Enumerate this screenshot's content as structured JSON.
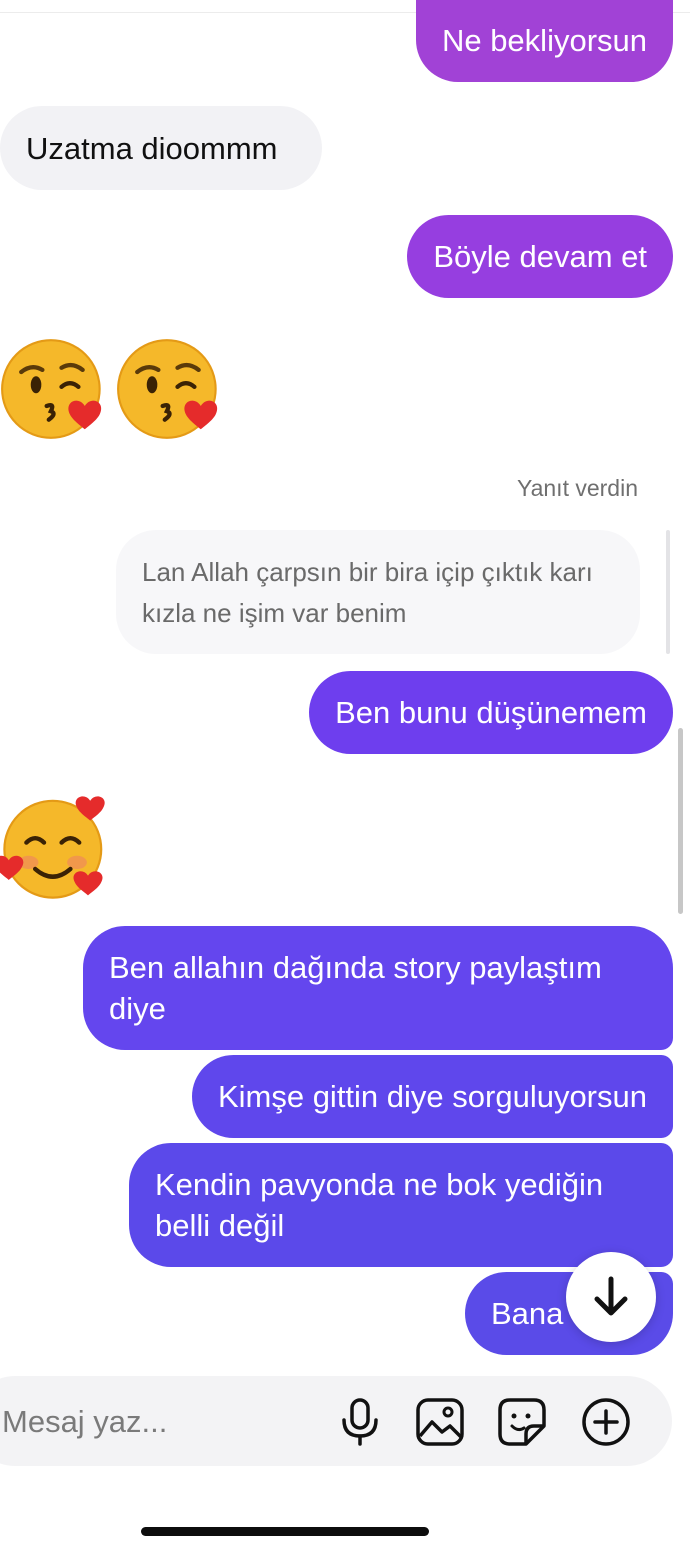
{
  "messages": {
    "m1": "Ne bekliyorsun",
    "m2": "Uzatma dioommm",
    "m3": "Böyle devam et",
    "reply_label": "Yanıt verdin",
    "reply_quote": "Lan Allah çarpsın bir bira içip çıktık karı kızla ne işim var benim",
    "m5": "Ben bunu düşünemem",
    "m6": "Ben allahın dağında story paylaştım diye",
    "m7": "Kimşe gittin diye sorguluyorsun",
    "m8": "Kendin pavyonda ne bok yediğin belli değil",
    "m9": "Bana"
  },
  "emojis": [
    "kissing-heart-emoji",
    "kissing-heart-emoji",
    "smiling-hearts-emoji"
  ],
  "composer": {
    "placeholder": "Mesaj yaz...",
    "icons": [
      "microphone-icon",
      "gallery-icon",
      "sticker-icon",
      "plus-icon"
    ]
  },
  "colors": {
    "accent_top": "#a142d6",
    "accent_bottom": "#5a4be8",
    "incoming": "#f2f2f5"
  }
}
